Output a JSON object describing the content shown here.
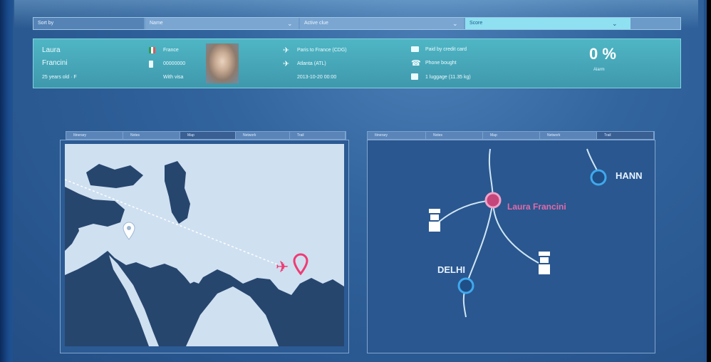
{
  "sort_bar": {
    "label": "Sort by",
    "field1": "Name",
    "field2": "Active clue",
    "field3": "Score"
  },
  "passenger": {
    "first_name": "Laura",
    "last_name": "Francini",
    "age": "25 years old · F",
    "nationality": "France",
    "document": "00000000",
    "visa": "With visa",
    "flight": "Paris to France (CDG)",
    "arrival": "Atlanta (ATL)",
    "datetime": "2013-10-20 00:00",
    "payment": "Paid by credit card",
    "phone": "Phone bought",
    "luggage": "1 luggage (11.35 kg)",
    "score": "0 %",
    "score_label": "Alarm"
  },
  "left_panel": {
    "tabs": [
      "Itinerary",
      "Notes",
      "Map",
      "Network",
      "Trail"
    ],
    "active_tab": 2
  },
  "right_panel": {
    "tabs": [
      "Itinerary",
      "Notes",
      "Map",
      "Network",
      "Trail"
    ],
    "active_tab": 4,
    "nodes": {
      "center": "Laura Francini",
      "delhi": "DELHI",
      "hann": "HANN"
    }
  },
  "colors": {
    "accent_teal": "#46a7b8",
    "pink_node": "#e46aa8",
    "blue_node": "#3fa9ee",
    "plane": "#ef3b73",
    "land": "#27466e"
  },
  "icons": [
    "flag-icon",
    "phone-icon",
    "plane-icon",
    "card-icon",
    "luggage-icon",
    "pin-icon",
    "officer-icon"
  ]
}
